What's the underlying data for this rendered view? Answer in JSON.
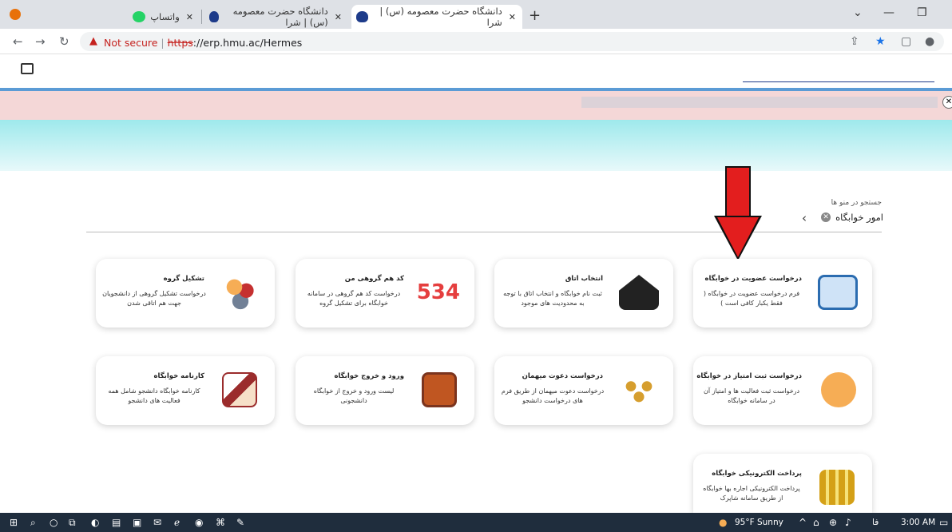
{
  "browser": {
    "tabs": [
      {
        "title": "واتساپ",
        "icon": "whatsapp-icon"
      },
      {
        "title": "دانشگاه حضرت معصومه (س) | شرا",
        "icon": "university-icon"
      },
      {
        "title": "دانشگاه حضرت معصومه (س) | شرا",
        "icon": "university-icon"
      }
    ],
    "new_tab": "+",
    "security_label": "Not secure",
    "url_scheme": "https",
    "url_rest": "://erp.hmu.ac/Hermes"
  },
  "page": {
    "menu_search_label": "جستجو در منو ها",
    "breadcrumb": "امور خوابگاه",
    "cards": [
      {
        "title": "درخواست عضویت در خوابگاه",
        "desc": "فرم درخواست عضویت در خوابگاه ( فقط یکبار کافی است )",
        "icon": "checklist-icon",
        "color": "#2b6cb0"
      },
      {
        "title": "انتخاب اتاق",
        "desc": "ثبت نام خوابگاه و انتخاب اتاق با توجه به محدودیت های موجود",
        "icon": "house-icon",
        "color": "#222222"
      },
      {
        "title": "کد هم گروهی من",
        "desc": "درخواست کد هم گروهی در سامانه خوابگاه برای تشکیل گروه",
        "icon": "numbers-icon",
        "color": "#e53e3e"
      },
      {
        "title": "تشکیل گروه",
        "desc": "درخواست تشکیل گروهی از دانشجویان جهت هم اتاقی شدن",
        "icon": "group-icon",
        "color": "#f6ad55"
      },
      {
        "title": "درخواست ثبت امتیاز در خوابگاه",
        "desc": "درخواست ثبت فعالیت ها و امتیاز آن در سامانه خوابگاه",
        "icon": "chart-icon",
        "color": "#ed8936"
      },
      {
        "title": "درخواست دعوت میهمان",
        "desc": "درخواست دعوت میهمان از طریق فرم های درخواست دانشجو",
        "icon": "guests-icon",
        "color": "#d69e2e"
      },
      {
        "title": "ورود و خروج خوابگاه",
        "desc": "لیست ورود و خروج از خوابگاه دانشجونی",
        "icon": "exit-door-icon",
        "color": "#c05621"
      },
      {
        "title": "کارنامه خوابگاه",
        "desc": "کارنامه خوابگاه دانشجو شامل همه فعالیت های دانشجو",
        "icon": "report-icon",
        "color": "#9b2c2c"
      },
      {
        "title": "پرداخت الکترونیکی خوابگاه",
        "desc": "پرداخت الکترونیکی اجاره بها خوابگاه از طریق سامانه شاپرک",
        "icon": "coins-icon",
        "color": "#d4a017"
      }
    ]
  },
  "taskbar": {
    "weather": "95°F  Sunny",
    "lang": "فا",
    "time": "3:00 AM"
  }
}
